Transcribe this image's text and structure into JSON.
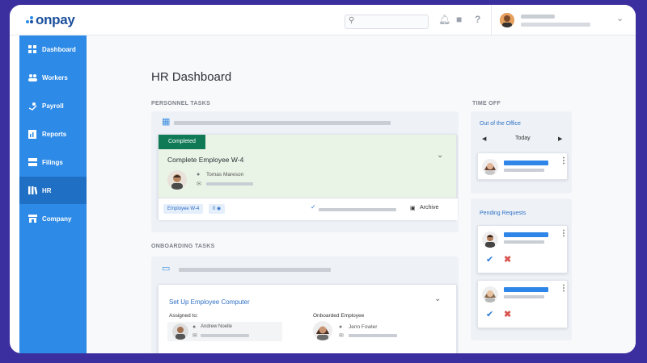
{
  "app": {
    "logo": "onpay"
  },
  "sidebar": {
    "items": [
      {
        "label": "Dashboard",
        "icon": "grid-icon"
      },
      {
        "label": "Workers",
        "icon": "workers-icon"
      },
      {
        "label": "Payroll",
        "icon": "payroll-icon"
      },
      {
        "label": "Reports",
        "icon": "reports-icon"
      },
      {
        "label": "Filings",
        "icon": "filings-icon"
      },
      {
        "label": "HR",
        "icon": "hr-icon"
      },
      {
        "label": "Company",
        "icon": "company-icon"
      }
    ],
    "active": "HR"
  },
  "main": {
    "title": "HR Dashboard",
    "personnel": {
      "label": "PERSONNEL TASKS",
      "card": {
        "status": "Completed",
        "task": "Complete Employee W-4",
        "person": "Tomas Mareson",
        "tag": "Employee W-4",
        "comments": "0",
        "archive": "Archive"
      }
    },
    "onboarding": {
      "label": "ONBOARDING TASKS",
      "card": {
        "task": "Set Up Employee Computer",
        "assigned_label": "Assigned to:",
        "assigned_name": "Andrew Noelle",
        "onboarded_label": "Onboarded Employee",
        "onboarded_name": "Jenn Fowler"
      }
    },
    "timeoff": {
      "label": "TIME OFF",
      "out_title": "Out of the Office",
      "day": "Today",
      "pending_title": "Pending Requests"
    }
  },
  "colors": {
    "sidebar": "#2d8ae6",
    "sidebar_active": "#1f6fc4",
    "accent_blue": "#2d7ad8",
    "completed_badge": "#0f7a55",
    "background": "#3b2e9e"
  }
}
